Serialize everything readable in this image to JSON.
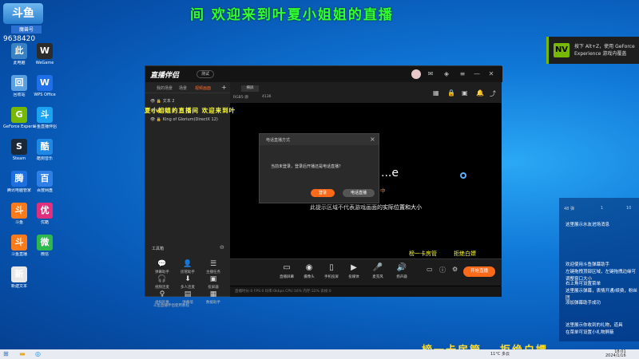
{
  "banner": {
    "title": "间 欢迎来到叶夏小姐姐的直播",
    "logo_glyph": "斗鱼",
    "badge": "魔兽号",
    "number": "9638420"
  },
  "desktop": [
    {
      "label": "此电脑",
      "icon": "computer-icon",
      "color": "#3b82c4"
    },
    {
      "label": "WeGame",
      "icon": "wegame-icon",
      "color": "#2c2c2c"
    },
    {
      "label": "回收站",
      "icon": "recycle-bin-icon",
      "color": "#5aa0e0"
    },
    {
      "label": "WPS Office",
      "icon": "wps-icon",
      "color": "#1f6feb"
    },
    {
      "label": "GeForce Experience",
      "icon": "nvidia-icon",
      "color": "#76b900"
    },
    {
      "label": "斗鱼直播伴侣",
      "icon": "douyu-icon",
      "color": "#1da1f2"
    },
    {
      "label": "Steam",
      "icon": "steam-icon",
      "color": "#1b2838"
    },
    {
      "label": "酷狗音乐",
      "icon": "kugou-icon",
      "color": "#1e88e5"
    },
    {
      "label": "腾讯电脑管家",
      "icon": "shield-icon",
      "color": "#1d6fe0"
    },
    {
      "label": "百度网盘",
      "icon": "baidu-icon",
      "color": "#2f7fe6"
    },
    {
      "label": "斗鱼",
      "icon": "douyu-app-icon",
      "color": "#ff7a1a"
    },
    {
      "label": "优酷",
      "icon": "youku-icon",
      "color": "#e0307d"
    },
    {
      "label": "斗鱼直播",
      "icon": "douyu-live-icon",
      "color": "#ff7a1a"
    },
    {
      "label": "微信",
      "icon": "wechat-icon",
      "color": "#2db84d"
    },
    {
      "label": "新建文本",
      "icon": "file-icon",
      "color": "#e8e8e8"
    }
  ],
  "nvidia": {
    "text": "按下 Alt+Z，使用 GeForce Experience 游戏内覆盖",
    "logo": "NV"
  },
  "app": {
    "name": "直播伴侣",
    "version": "测试",
    "tabs": [
      "我的场景",
      "场景",
      "视频画面"
    ],
    "sources": [
      "文本 2",
      "文本 1",
      "King of Glorium(DirectX 12)"
    ],
    "tools_title": "工具箱",
    "tools": [
      {
        "label": "弹幕助手",
        "glyph": "💬"
      },
      {
        "label": "房管助手",
        "glyph": "👤"
      },
      {
        "label": "主播任务",
        "glyph": "☰"
      },
      {
        "label": "视频连麦",
        "glyph": "🎧"
      },
      {
        "label": "多人连麦",
        "glyph": "⬇"
      },
      {
        "label": "投屏器",
        "glyph": "▣"
      },
      {
        "label": "虚拟形象",
        "glyph": "♀"
      },
      {
        "label": "弹幕墙",
        "glyph": "▤"
      },
      {
        "label": "数据助手",
        "glyph": "▦"
      }
    ],
    "footer": "斗鱼直播伴侣使用教程",
    "preview_tabs": [
      "RGB5-源",
      "4136"
    ],
    "preview_top_tab": "横屏",
    "preview": {
      "title": "夏小姐姐的直播间 欢迎来到叶",
      "e_text": "...e",
      "orange_text": "中",
      "area_text": "此提示区域不代表游戏画面的实际位置和大小",
      "line1": "榜一卡房管",
      "line2": "拒绝白嫖"
    },
    "bottom_tools": [
      {
        "label": "直播屏幕",
        "glyph": "▭"
      },
      {
        "label": "摄像头",
        "glyph": "◉"
      },
      {
        "label": "手机投屏",
        "glyph": "▯"
      },
      {
        "label": "投媒体",
        "glyph": "▶"
      },
      {
        "label": "麦克风",
        "glyph": "🎤"
      },
      {
        "label": "扬声器",
        "glyph": "🔊"
      }
    ],
    "go_live": "开始直播",
    "status": "直播时长:0  FPS:0  码率:0kbps  CPU:16%  内存:32%  丢帧:0"
  },
  "dialog": {
    "title": "电话直播方式",
    "message": "当前未登录，登录后开播还是电话直播？",
    "ok": "登录",
    "alt": "电话直播"
  },
  "chat": {
    "stats": [
      "48 弹",
      "1",
      "10"
    ],
    "lines": [
      "这里展示水友进场消息",
      "欢迎使用斗鱼弹幕助手",
      "左键拖拽顶部区域，左键拖拽边缘可调整窗口大小",
      "右上角可设置菜单",
      "这里展示弹幕，表情开通/续费，粉丝团",
      "添加弹幕助手成功",
      "这里展示你收到的礼物，道具",
      "在菜单可设置小礼物屏蔽"
    ]
  },
  "overlay": {
    "left": "榜一卡房管",
    "right": "拒绝白嫖"
  },
  "taskbar": {
    "tray": "11°C 多云",
    "time": "18:01",
    "date": "2024/1/16"
  }
}
